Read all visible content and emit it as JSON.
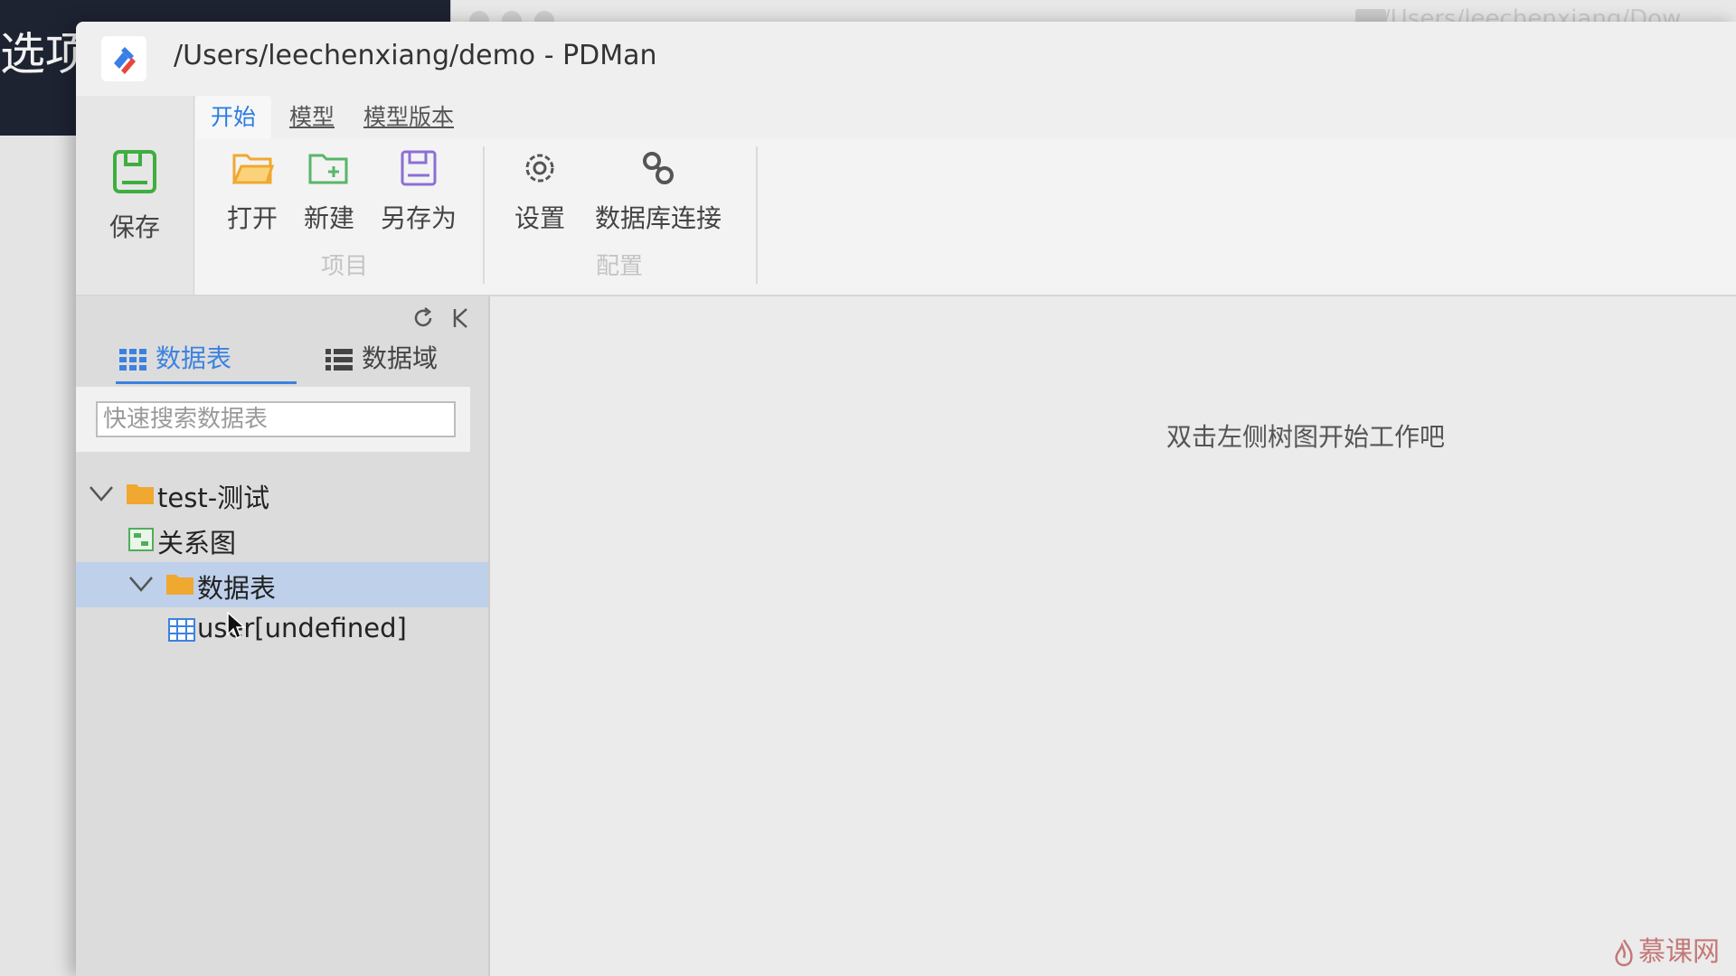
{
  "background": {
    "left_window_text": "选项目",
    "right_window_path": "/Users/leechenxiang/Dow"
  },
  "app": {
    "title": "/Users/leechenxiang/demo - PDMan",
    "accent_color": "#2a7be4"
  },
  "tabs": [
    {
      "label": "开始",
      "active": true
    },
    {
      "label": "模型",
      "active": false
    },
    {
      "label": "模型版本",
      "active": false
    }
  ],
  "ribbon": {
    "save_label": "保存",
    "project_group": {
      "label": "项目",
      "buttons": [
        {
          "label": "打开",
          "icon": "folder-open-icon"
        },
        {
          "label": "新建",
          "icon": "folder-add-icon"
        },
        {
          "label": "另存为",
          "icon": "save-as-icon"
        }
      ]
    },
    "config_group": {
      "label": "配置",
      "buttons": [
        {
          "label": "设置",
          "icon": "gear-icon"
        },
        {
          "label": "数据库连接",
          "icon": "link-icon"
        }
      ]
    }
  },
  "sidebar": {
    "tabs": [
      {
        "label": "数据表",
        "icon": "grid-icon",
        "active": true
      },
      {
        "label": "数据域",
        "icon": "list-icon",
        "active": false
      }
    ],
    "search_placeholder": "快速搜索数据表",
    "tree": [
      {
        "label": "test-测试",
        "type": "folder",
        "expanded": true
      },
      {
        "label": "关系图",
        "type": "diagram"
      },
      {
        "label": "数据表",
        "type": "folder",
        "expanded": true,
        "selected": true
      },
      {
        "label": "user[undefined]",
        "type": "table"
      }
    ]
  },
  "content": {
    "hint": "双击左侧树图开始工作吧"
  },
  "watermark": "慕课网"
}
